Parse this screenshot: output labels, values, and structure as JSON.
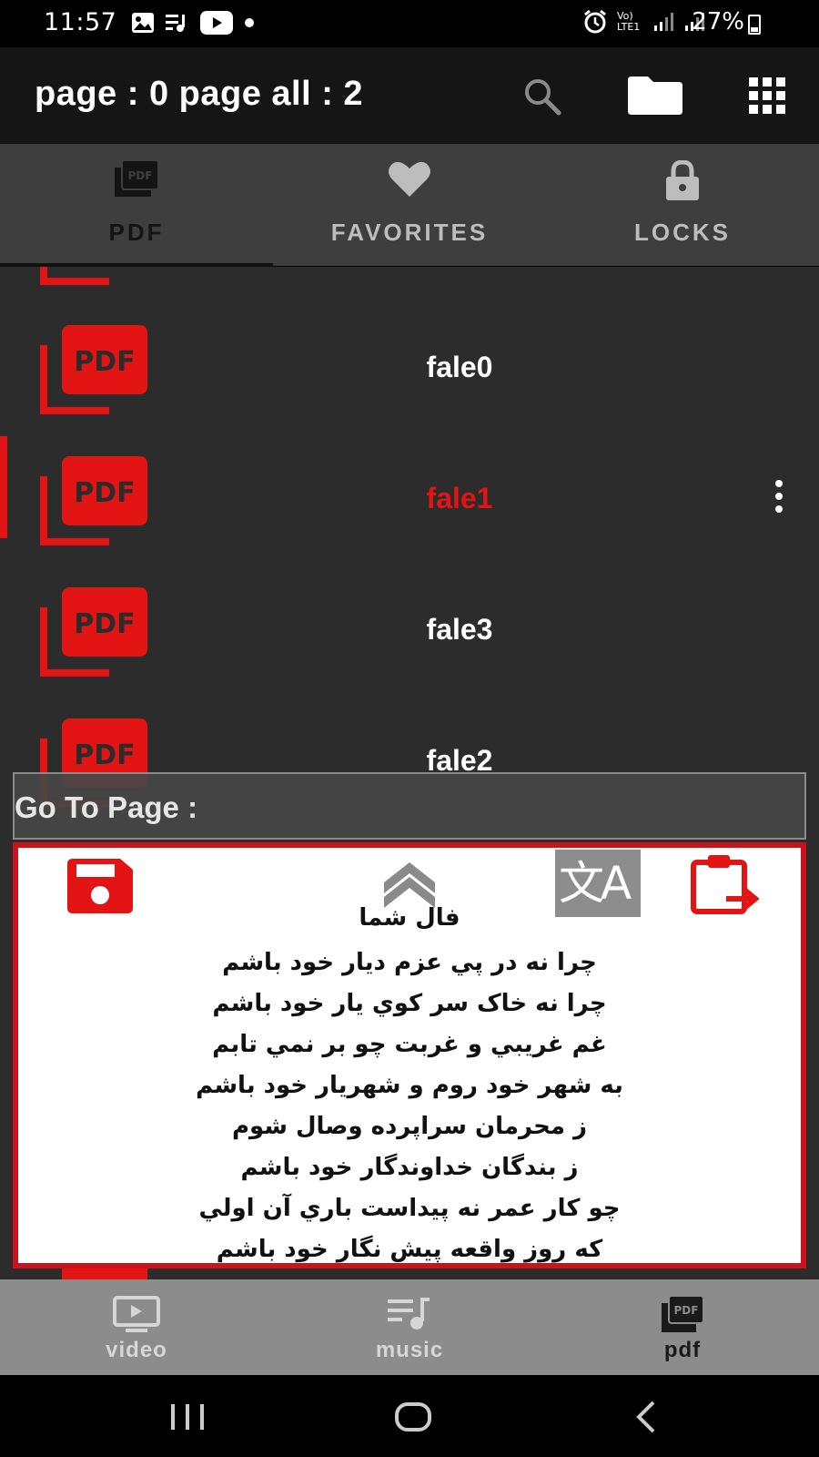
{
  "status_bar": {
    "time": "11:57",
    "battery_percent": "27%",
    "network_label": "Vo) LTE1",
    "left_icons": [
      "gallery-icon",
      "playlist-icon",
      "youtube-icon",
      "dot-icon"
    ],
    "right_icons": [
      "alarm-icon",
      "signal-icon",
      "signal-icon",
      "battery-icon"
    ]
  },
  "app_bar": {
    "title": "page : 0 page all : 2",
    "actions": [
      "search-icon",
      "folder-icon",
      "apps-grid-icon"
    ]
  },
  "tabs": [
    {
      "label": "PDF",
      "icon": "pdf-stack-icon",
      "active": true
    },
    {
      "label": "FAVORITES",
      "icon": "heart-icon",
      "active": false
    },
    {
      "label": "LOCKS",
      "icon": "lock-icon",
      "active": false
    }
  ],
  "file_list": [
    {
      "name": "",
      "selected": false
    },
    {
      "name": "fale0",
      "selected": false
    },
    {
      "name": "fale1",
      "selected": true
    },
    {
      "name": "fale3",
      "selected": false
    },
    {
      "name": "fale2",
      "selected": false
    }
  ],
  "goto_page": {
    "label": "Go To Page :"
  },
  "poem_panel": {
    "title": "فال شما",
    "lines": [
      "چرا نه در پي عزم ديار خود باشم",
      "چرا نه خاک سر کوي يار خود باشم",
      "غم غريبي و غربت چو بر نمي تابم",
      "به شهر خود روم و شهريار خود باشم",
      "ز محرمان سراپرده وصال شوم",
      "ز بندگان خداوندگار خود باشم",
      "چو کار عمر نه پيداست باري آن اولي",
      "که روز واقعه پيش نگار خود باشم"
    ],
    "icon_thumb_label": "PDF",
    "translate_glyphs": "文A"
  },
  "bottom_nav": [
    {
      "label": "video",
      "icon": "video-icon",
      "active": false
    },
    {
      "label": "music",
      "icon": "music-icon",
      "active": false
    },
    {
      "label": "pdf",
      "icon": "pdf-stack-icon",
      "active": true
    }
  ],
  "colors": {
    "accent_red": "#e21414",
    "panel_border": "#c8141a",
    "app_bar_bg": "#151515",
    "tabs_bg": "#3e3e3e",
    "list_bg": "#2c2c2c",
    "bottom_nav_bg": "#8c8c8c"
  }
}
